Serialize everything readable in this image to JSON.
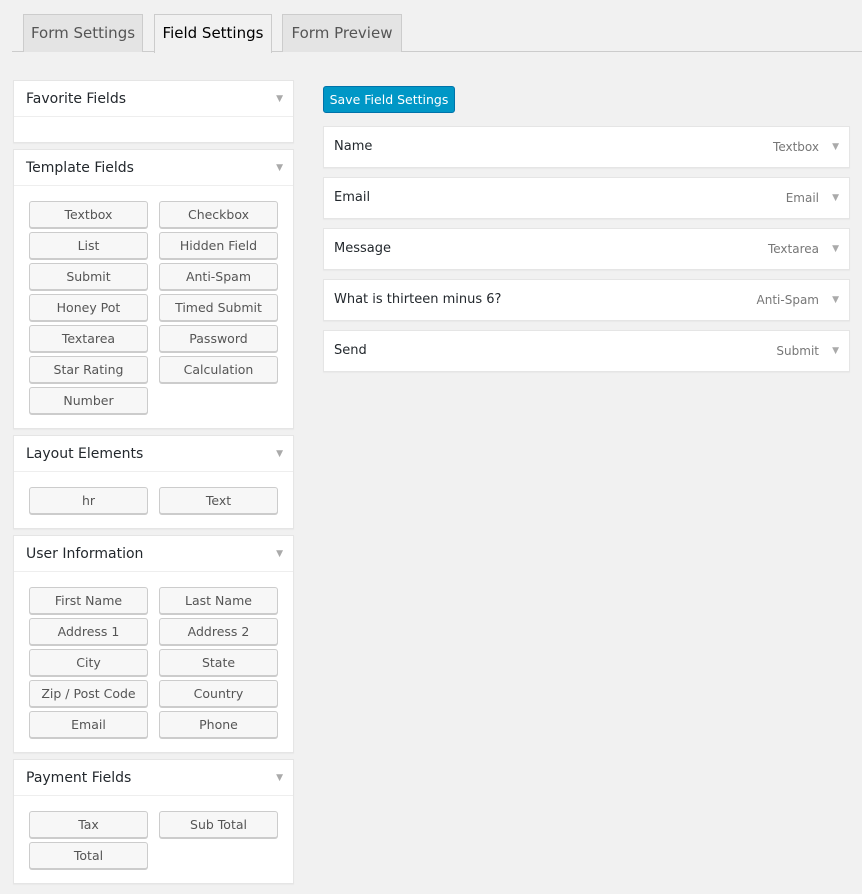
{
  "tabs": [
    {
      "label": "Form Settings"
    },
    {
      "label": "Field Settings"
    },
    {
      "label": "Form Preview"
    }
  ],
  "panels": [
    {
      "title": "Favorite Fields",
      "buttons": []
    },
    {
      "title": "Template Fields",
      "buttons": [
        "Textbox",
        "Checkbox",
        "List",
        "Hidden Field",
        "Submit",
        "Anti-Spam",
        "Honey Pot",
        "Timed Submit",
        "Textarea",
        "Password",
        "Star Rating",
        "Calculation",
        "Number"
      ]
    },
    {
      "title": "Layout Elements",
      "buttons": [
        "hr",
        "Text"
      ]
    },
    {
      "title": "User Information",
      "buttons": [
        "First Name",
        "Last Name",
        "Address 1",
        "Address 2",
        "City",
        "State",
        "Zip / Post Code",
        "Country",
        "Email",
        "Phone"
      ]
    },
    {
      "title": "Payment Fields",
      "buttons": [
        "Tax",
        "Sub Total",
        "Total"
      ]
    }
  ],
  "save_label": "Save Field Settings",
  "fields": [
    {
      "label": "Name",
      "type": "Textbox"
    },
    {
      "label": "Email",
      "type": "Email"
    },
    {
      "label": "Message",
      "type": "Textarea"
    },
    {
      "label": "What is thirteen minus 6?",
      "type": "Anti-Spam"
    },
    {
      "label": "Send",
      "type": "Submit"
    }
  ],
  "colors": {
    "accent": "#0097c6"
  }
}
